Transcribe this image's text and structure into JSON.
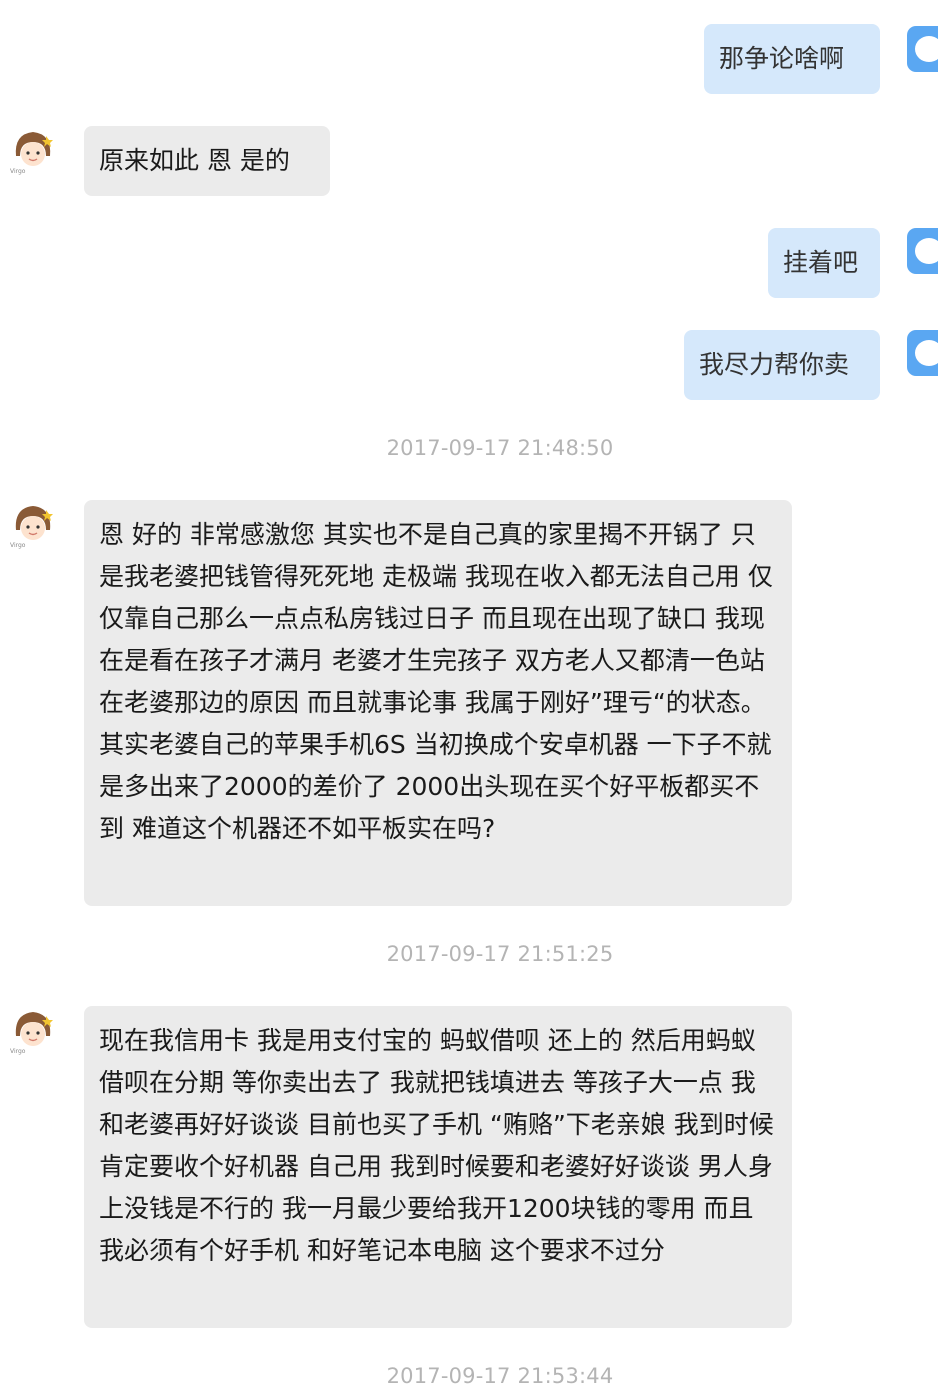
{
  "conversation": [
    {
      "type": "message",
      "side": "out",
      "text": "那争论啥啊"
    },
    {
      "type": "message",
      "side": "in",
      "text": "原来如此  恩 是的"
    },
    {
      "type": "message",
      "side": "out",
      "text": "挂着吧"
    },
    {
      "type": "message",
      "side": "out",
      "text": "我尽力帮你卖"
    },
    {
      "type": "timestamp",
      "text": "2017-09-17 21:48:50"
    },
    {
      "type": "message",
      "side": "in",
      "text": "恩 好的 非常感激您   其实也不是自己真的家里揭不开锅了  只是我老婆把钱管得死死地 走极端 我现在收入都无法自己用 仅仅靠自己那么一点点私房钱过日子  而且现在出现了缺口  我现在是看在孩子才满月 老婆才生完孩子 双方老人又都清一色站在老婆那边的原因  而且就事论事 我属于刚好”理亏“的状态。   其实老婆自己的苹果手机6S 当初换成个安卓机器  一下子不就是多出来了2000的差价了   2000出头现在买个好平板都买不到  难道这个机器还不如平板实在吗?"
    },
    {
      "type": "timestamp",
      "text": "2017-09-17 21:51:25"
    },
    {
      "type": "message",
      "side": "in",
      "text": "现在我信用卡  我是用支付宝的 蚂蚁借呗   还上的 然后用蚂蚁借呗在分期  等你卖出去了 我就把钱填进去   等孩子大一点 我和老婆再好好谈谈  目前也买了手机 “贿赂”下老亲娘    我到时候肯定要收个好机器  自己用  我到时候要和老婆好好谈谈  男人身上没钱是不行的 我一月最少要给我开1200块钱的零用  而且我必须有个好手机 和好笔记本电脑 这个要求不过分"
    },
    {
      "type": "timestamp",
      "text": "2017-09-17 21:53:44"
    }
  ],
  "avatar": {
    "contact_icon": "girl-avatar-icon",
    "contact_badge": "Virgo",
    "self_icon": "blue-cat-avatar-icon"
  },
  "colors": {
    "outgoing_bubble": "#d5e8fb",
    "incoming_bubble": "#ebebeb",
    "timestamp": "#b4b4b4",
    "self_avatar": "#5aa7f2"
  }
}
